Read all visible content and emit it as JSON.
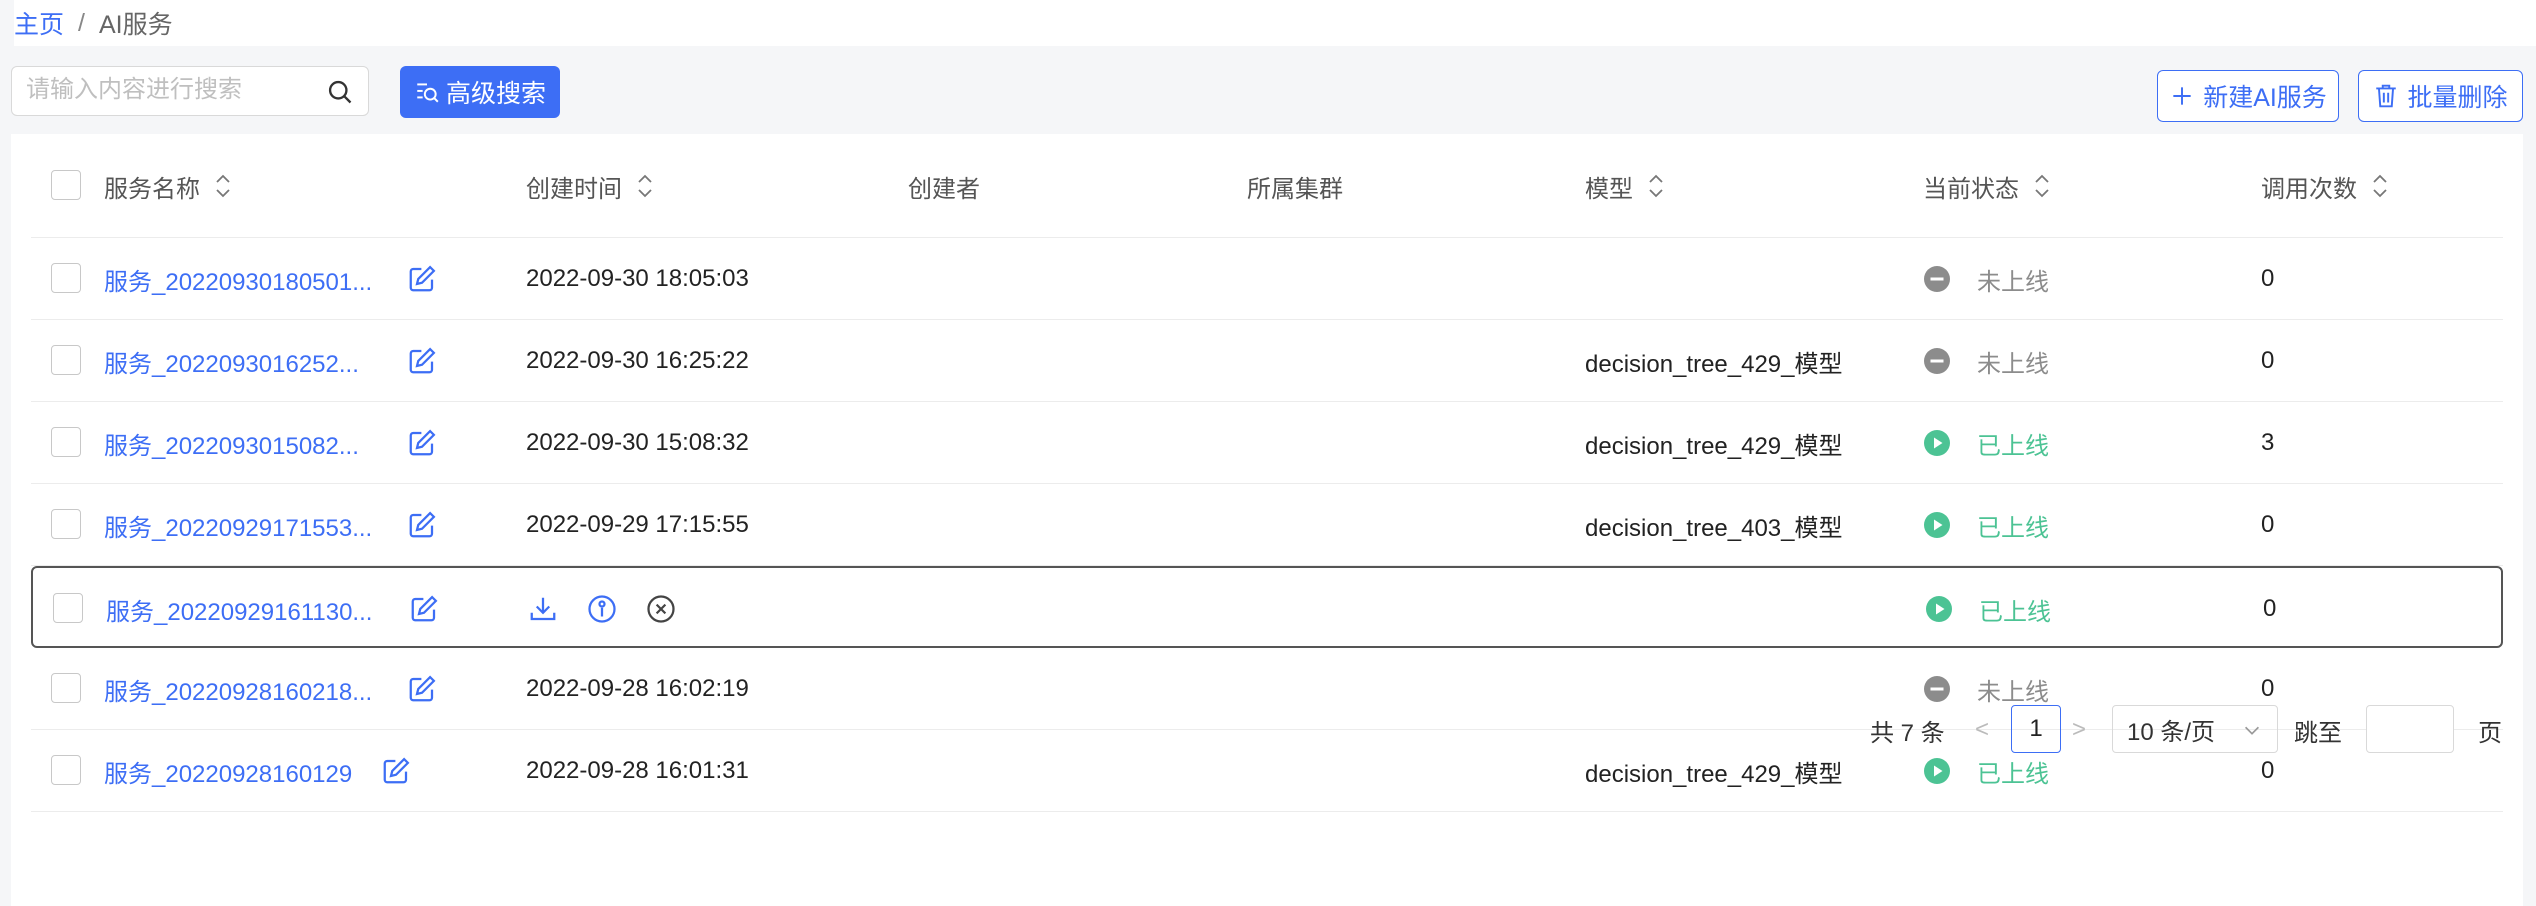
{
  "breadcrumb": {
    "home": "主页",
    "separator": "/",
    "current": "AI服务"
  },
  "search": {
    "placeholder": "请输入内容进行搜索",
    "value": ""
  },
  "toolbar": {
    "advanced_search": "高级搜索",
    "new_service": "新建AI服务",
    "batch_delete": "批量删除"
  },
  "columns": {
    "name": "服务名称",
    "created_at": "创建时间",
    "creator": "创建者",
    "cluster": "所属集群",
    "model": "模型",
    "status": "当前状态",
    "calls": "调用次数"
  },
  "rows": [
    {
      "name": "服务_20220930180501...",
      "created_at": "2022-09-30 18:05:03",
      "creator": "",
      "cluster": "",
      "model": "",
      "status": "未上线",
      "status_type": "offline",
      "calls": "0"
    },
    {
      "name": "服务_2022093016252...",
      "created_at": "2022-09-30 16:25:22",
      "creator": "",
      "cluster": "",
      "model": "decision_tree_429_模型",
      "status": "未上线",
      "status_type": "offline",
      "calls": "0"
    },
    {
      "name": "服务_2022093015082...",
      "created_at": "2022-09-30 15:08:32",
      "creator": "",
      "cluster": "",
      "model": "decision_tree_429_模型",
      "status": "已上线",
      "status_type": "online",
      "calls": "3"
    },
    {
      "name": "服务_20220929171553...",
      "created_at": "2022-09-29 17:15:55",
      "creator": "",
      "cluster": "",
      "model": "decision_tree_403_模型",
      "status": "已上线",
      "status_type": "online",
      "calls": "0"
    },
    {
      "name": "服务_20220929161130...",
      "created_at": "",
      "creator": "",
      "cluster": "",
      "model": "",
      "status": "已上线",
      "status_type": "online",
      "calls": "0",
      "hover_actions": [
        "download-icon",
        "info-icon",
        "close-circle-icon"
      ]
    },
    {
      "name": "服务_20220928160218...",
      "created_at": "2022-09-28 16:02:19",
      "creator": "",
      "cluster": "",
      "model": "",
      "status": "未上线",
      "status_type": "offline",
      "calls": "0"
    },
    {
      "name": "服务_20220928160129",
      "created_at": "2022-09-28 16:01:31",
      "creator": "",
      "cluster": "",
      "model": "decision_tree_429_模型",
      "status": "已上线",
      "status_type": "online",
      "calls": "0"
    }
  ],
  "pagination": {
    "total": "共 7 条",
    "prev": "<",
    "current_page": "1",
    "next": ">",
    "page_size": "10 条/页",
    "jump_label": "跳至",
    "jump_value": "",
    "page_unit": "页"
  },
  "colors": {
    "primary": "#3d6ef5",
    "online": "#4cc394",
    "offline": "#8c8c8c"
  }
}
